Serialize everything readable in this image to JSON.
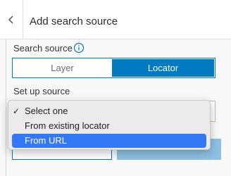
{
  "header": {
    "title": "Add search source"
  },
  "fields": {
    "search_source_label": "Search source",
    "setup_source_label": "Set up source"
  },
  "segmented": {
    "layer": "Layer",
    "locator": "Locator"
  },
  "dropdown": {
    "options": [
      {
        "label": "Select one",
        "checked": true
      },
      {
        "label": "From existing locator"
      },
      {
        "label": "From URL",
        "highlighted": true
      }
    ],
    "check_glyph": "✓"
  },
  "colors": {
    "accent": "#007ac2",
    "highlight": "#3478f6",
    "button_disabled": "#8ec0e3"
  }
}
